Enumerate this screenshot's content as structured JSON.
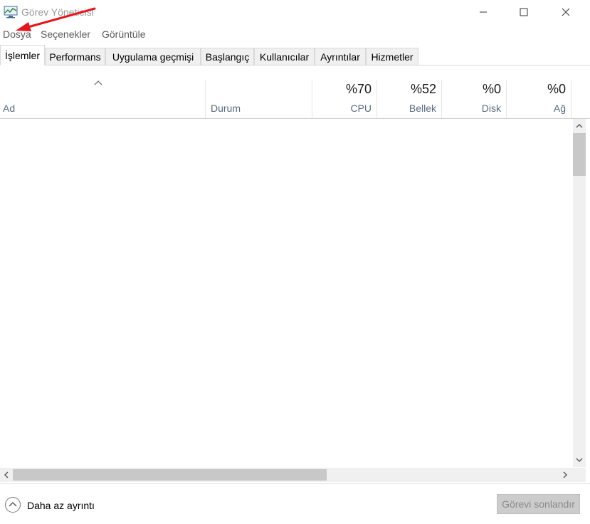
{
  "window": {
    "title": "Görev Yöneticisi",
    "controls": [
      "minimize-icon",
      "maximize-icon",
      "close-icon"
    ]
  },
  "menu": {
    "items": [
      "Dosya",
      "Seçenekler",
      "Görüntüle"
    ]
  },
  "tabs": [
    {
      "label": "İşlemler",
      "active": true
    },
    {
      "label": "Performans",
      "active": false
    },
    {
      "label": "Uygulama geçmişi",
      "active": false
    },
    {
      "label": "Başlangıç",
      "active": false
    },
    {
      "label": "Kullanıcılar",
      "active": false
    },
    {
      "label": "Ayrıntılar",
      "active": false
    },
    {
      "label": "Hizmetler",
      "active": false
    }
  ],
  "columns": [
    {
      "label": "Ad",
      "value": ""
    },
    {
      "label": "Durum",
      "value": ""
    },
    {
      "label": "CPU",
      "value": "%70"
    },
    {
      "label": "Bellek",
      "value": "%52"
    },
    {
      "label": "Disk",
      "value": "%0"
    },
    {
      "label": "Ağ",
      "value": "%0"
    }
  ],
  "footer": {
    "fewer_details": "Daha az ayrıntı",
    "end_task": "Görevi sonlandır"
  },
  "annotation": {
    "color": "#e8141b"
  },
  "colors": {
    "header_label": "#5a6b80",
    "scrollbar_track": "#f0f0f0",
    "scrollbar_thumb": "#c8c8c8"
  }
}
